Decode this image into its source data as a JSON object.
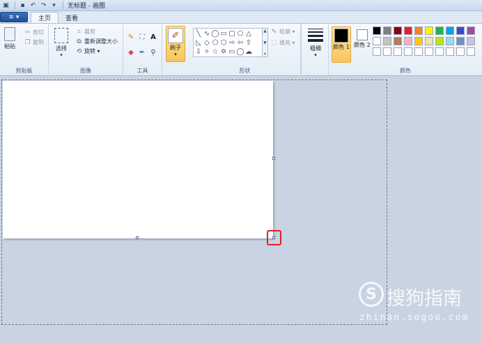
{
  "window": {
    "title": "无标题 - 画图"
  },
  "tabs": {
    "file_menu": "≡ ▾",
    "home": "主页",
    "view": "查看"
  },
  "ribbon": {
    "clipboard": {
      "label": "剪贴板",
      "paste": "粘贴",
      "cut": "剪切",
      "copy": "复制"
    },
    "image": {
      "label": "图像",
      "select": "选择",
      "crop": "裁剪",
      "resize": "重新调整大小",
      "rotate": "旋转 ▾"
    },
    "tools": {
      "label": "工具"
    },
    "brushes": {
      "label": "刷子"
    },
    "shapes": {
      "label": "形状",
      "outline": "轮廓 ▾",
      "fill": "填充 ▾"
    },
    "size": {
      "label": "粗细"
    },
    "colors": {
      "label": "颜色",
      "color1": "颜色 1",
      "color2": "颜色 2",
      "color1_value": "#000000",
      "color2_value": "#ffffff",
      "palette_row1": [
        "#000000",
        "#7f7f7f",
        "#880015",
        "#ed1c24",
        "#ff7f27",
        "#fff200",
        "#22b14c",
        "#00a2e8",
        "#3f48cc",
        "#a349a4"
      ],
      "palette_row2": [
        "#ffffff",
        "#c3c3c3",
        "#b97a57",
        "#ffaec9",
        "#ffc90e",
        "#efe4b0",
        "#b5e61d",
        "#99d9ea",
        "#7092be",
        "#c8bfe7"
      ],
      "palette_row3": [
        "#ffffff",
        "#ffffff",
        "#ffffff",
        "#ffffff",
        "#ffffff",
        "#ffffff",
        "#ffffff",
        "#ffffff",
        "#ffffff",
        "#ffffff"
      ]
    }
  },
  "watermark": {
    "logo": "S",
    "main": "搜狗指南",
    "url": "zhinan.sogou.com"
  },
  "accent": {
    "highlight": "#e0202a"
  }
}
